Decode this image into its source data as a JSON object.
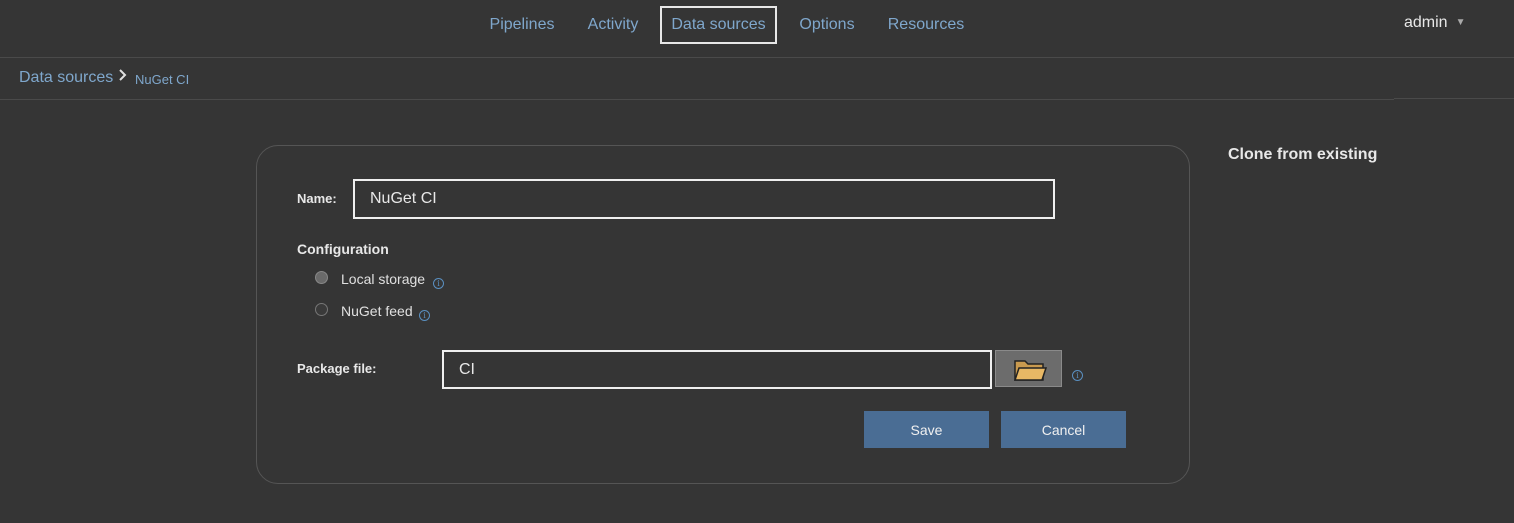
{
  "nav": {
    "items": [
      {
        "label": "Pipelines"
      },
      {
        "label": "Activity"
      },
      {
        "label": "Data sources"
      },
      {
        "label": "Options"
      },
      {
        "label": "Resources"
      }
    ],
    "active_index": 2,
    "user": "admin"
  },
  "breadcrumb": {
    "root": "Data sources",
    "separator": ">",
    "current": "NuGet CI"
  },
  "form": {
    "name_label": "Name:",
    "name_value": "NuGet CI",
    "configuration_title": "Configuration",
    "options": [
      {
        "label": "Local storage",
        "checked": true
      },
      {
        "label": "NuGet feed",
        "checked": false
      }
    ],
    "package_label": "Package file:",
    "package_value": "CI",
    "save_label": "Save",
    "cancel_label": "Cancel"
  },
  "sidebar": {
    "clone_title": "Clone from existing"
  },
  "icons": {
    "info": "info-icon",
    "folder": "folder-icon",
    "caret": "caret-down-icon",
    "chevron": "chevron-right-icon"
  },
  "colors": {
    "background": "#353535",
    "link": "#7fa7cc",
    "button": "#4a6d94",
    "folder": "#e0b466"
  }
}
